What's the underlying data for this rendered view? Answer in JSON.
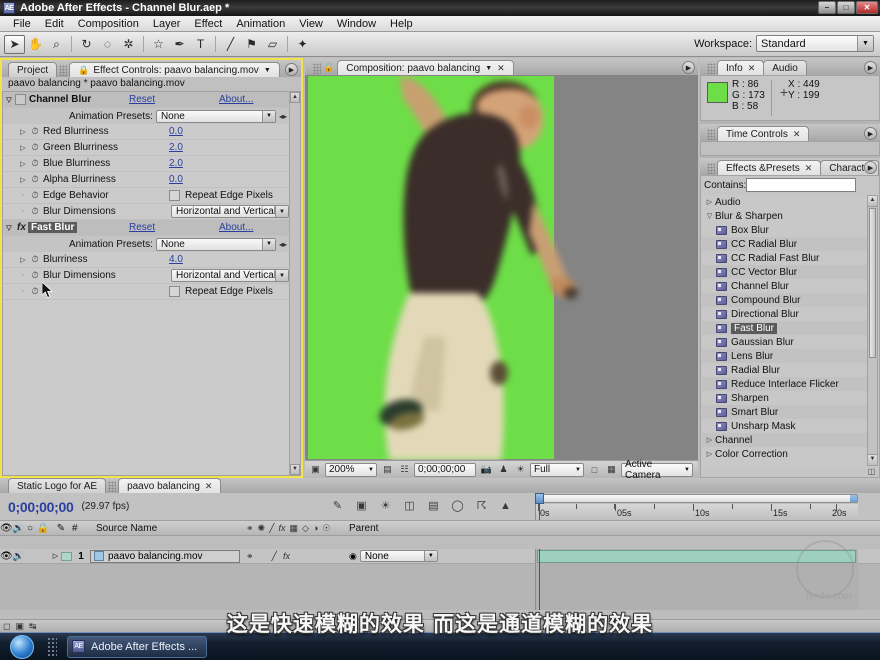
{
  "window": {
    "title": "Adobe After Effects - Channel Blur.aep *",
    "app_badge": "AE",
    "minimize": "–",
    "maximize": "□",
    "close": "✕"
  },
  "menu": [
    "File",
    "Edit",
    "Composition",
    "Layer",
    "Effect",
    "Animation",
    "View",
    "Window",
    "Help"
  ],
  "toolbar": {
    "tools": [
      {
        "name": "selection-tool",
        "glyph": "➤"
      },
      {
        "name": "hand-tool",
        "glyph": "✋"
      },
      {
        "name": "zoom-tool",
        "glyph": "⌕"
      },
      {
        "name": "rotation-tool",
        "glyph": "↻"
      },
      {
        "name": "camera-tool",
        "glyph": "◌"
      },
      {
        "name": "pan-behind-tool",
        "glyph": "✲"
      },
      {
        "name": "shape-tool",
        "glyph": "☆"
      },
      {
        "name": "pen-tool",
        "glyph": "✒"
      },
      {
        "name": "type-tool",
        "glyph": "T"
      },
      {
        "name": "brush-tool",
        "glyph": "╱"
      },
      {
        "name": "clone-stamp-tool",
        "glyph": "⚑"
      },
      {
        "name": "eraser-tool",
        "glyph": "▱"
      },
      {
        "name": "puppet-tool",
        "glyph": "✦"
      }
    ],
    "workspace_label": "Workspace:",
    "workspace_value": "Standard"
  },
  "effect_controls": {
    "tabs": [
      {
        "label": "Project",
        "selected": false,
        "closable": false
      },
      {
        "label": "Effect Controls: paavo balancing.mov",
        "selected": true,
        "closable": false
      }
    ],
    "header": "paavo balancing * paavo balancing.mov",
    "effects": [
      {
        "name": "Channel Blur",
        "reset": "Reset",
        "about": "About...",
        "selected": false,
        "preset_label": "Animation Presets:",
        "preset_value": "None",
        "params": [
          {
            "label": "Red Blurriness",
            "value": "0.0",
            "type": "number"
          },
          {
            "label": "Green Blurriness",
            "value": "2.0",
            "type": "number"
          },
          {
            "label": "Blue Blurriness",
            "value": "2.0",
            "type": "number"
          },
          {
            "label": "Alpha Blurriness",
            "value": "0.0",
            "type": "number"
          },
          {
            "label": "Edge Behavior",
            "value": "Repeat Edge Pixels",
            "type": "checkbox"
          },
          {
            "label": "Blur Dimensions",
            "value": "Horizontal and Vertical",
            "type": "select"
          }
        ]
      },
      {
        "name": "Fast Blur",
        "reset": "Reset",
        "about": "About...",
        "selected": true,
        "preset_label": "Animation Presets:",
        "preset_value": "None",
        "params": [
          {
            "label": "Blurriness",
            "value": "4.0",
            "type": "number"
          },
          {
            "label": "Blur Dimensions",
            "value": "Horizontal and Vertical",
            "type": "select"
          },
          {
            "label": "",
            "value": "Repeat Edge Pixels",
            "type": "checkbox"
          }
        ]
      }
    ]
  },
  "composition": {
    "tab_label": "Composition: paavo balancing",
    "bottom_bar": {
      "zoom": "200%",
      "timecode": "0;00;00;00",
      "resolution": "Full",
      "view": "Active Camera"
    }
  },
  "info_panel": {
    "tabs": [
      {
        "label": "Info",
        "selected": true
      },
      {
        "label": "Audio",
        "selected": false
      }
    ],
    "r_label": "R :",
    "r_value": "86",
    "g_label": "G :",
    "g_value": "173",
    "b_label": "B :",
    "b_value": "58",
    "x_label": "X :",
    "x_value": "449",
    "y_label": "Y :",
    "y_value": "199",
    "swatch_color": "#6ede48"
  },
  "time_controls": {
    "tabs": [
      {
        "label": "Time Controls",
        "selected": true
      }
    ]
  },
  "effects_presets": {
    "tabs": [
      {
        "label": "Effects &Presets",
        "selected": true
      },
      {
        "label": "Characte",
        "selected": false
      }
    ],
    "contains_label": "Contains:",
    "contains_value": "",
    "items": [
      {
        "label": "Audio",
        "type": "category",
        "expanded": false
      },
      {
        "label": "Blur & Sharpen",
        "type": "category",
        "expanded": true
      },
      {
        "label": "Box Blur",
        "type": "effect",
        "selected": false
      },
      {
        "label": "CC Radial Blur",
        "type": "effect",
        "selected": false
      },
      {
        "label": "CC Radial Fast Blur",
        "type": "effect",
        "selected": false
      },
      {
        "label": "CC Vector Blur",
        "type": "effect",
        "selected": false
      },
      {
        "label": "Channel Blur",
        "type": "effect",
        "selected": false
      },
      {
        "label": "Compound Blur",
        "type": "effect",
        "selected": false
      },
      {
        "label": "Directional Blur",
        "type": "effect",
        "selected": false
      },
      {
        "label": "Fast Blur",
        "type": "effect",
        "selected": true
      },
      {
        "label": "Gaussian Blur",
        "type": "effect",
        "selected": false
      },
      {
        "label": "Lens Blur",
        "type": "effect",
        "selected": false
      },
      {
        "label": "Radial Blur",
        "type": "effect",
        "selected": false
      },
      {
        "label": "Reduce Interlace Flicker",
        "type": "effect",
        "selected": false
      },
      {
        "label": "Sharpen",
        "type": "effect",
        "selected": false
      },
      {
        "label": "Smart Blur",
        "type": "effect",
        "selected": false
      },
      {
        "label": "Unsharp Mask",
        "type": "effect",
        "selected": false
      },
      {
        "label": "Channel",
        "type": "category",
        "expanded": false
      },
      {
        "label": "Color Correction",
        "type": "category",
        "expanded": false
      }
    ]
  },
  "timeline": {
    "tabs": [
      {
        "label": "Static Logo for AE",
        "selected": false
      },
      {
        "label": "paavo balancing",
        "selected": true
      }
    ],
    "timecode": "0;00;00;00",
    "fps": "(29.97 fps)",
    "columns": [
      "#",
      "Source Name",
      "Parent"
    ],
    "ruler_labels": [
      "0s",
      "05s",
      "10s",
      "15s",
      "20s"
    ],
    "rows": [
      {
        "index": "1",
        "source_name": "paavo balancing.mov",
        "parent": "None"
      }
    ]
  },
  "subtitle": "这是快速模糊的效果 而这是通道模糊的效果",
  "watermark": "lynda.com",
  "taskbar": {
    "start_label": "",
    "items": [
      {
        "label": "Adobe After Effects ...",
        "badge": "AE"
      }
    ]
  }
}
